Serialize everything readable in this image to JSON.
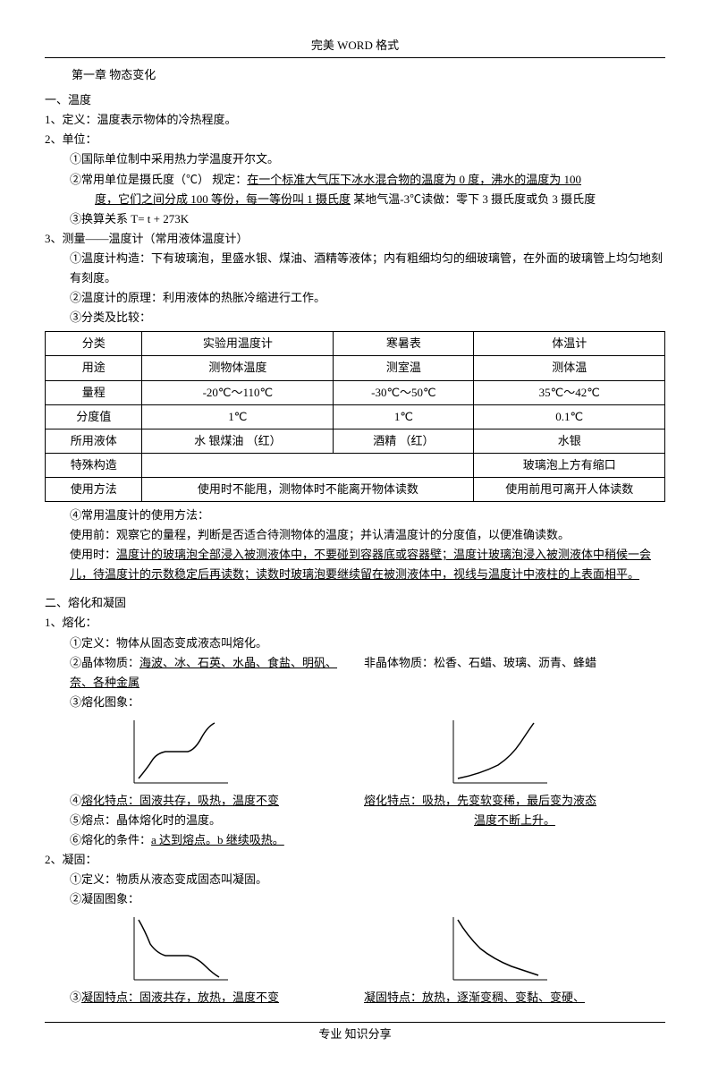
{
  "header": "完美 WORD 格式",
  "footer": "专业 知识分享",
  "chapter": "第一章   物态变化",
  "s1": {
    "title": "一、温度",
    "def": "1、定义：温度表示物体的冷热程度。",
    "unit_label": "2、单位：",
    "u1": "①国际单位制中采用热力学温度开尔文。",
    "u2a": "②常用单位是摄氏度（℃）  规定：",
    "u2b": "在一个标准大气压下冰水混合物的温度为 0 度，沸水的温度为 100",
    "u2c": "度，它们之间分成 100 等份，每一等份叫 1 摄氏度",
    "u2d": "  某地气温-3℃读做：零下 3 摄氏度或负 3 摄氏度",
    "u3": "③换算关系 T= t  + 273K",
    "measure_title": "3、测量——温度计（常用液体温度计）",
    "m1": "①温度计构造：下有玻璃泡，里盛水银、煤油、酒精等液体；内有粗细均匀的细玻璃管，在外面的玻璃管上均匀地刻有刻度。",
    "m2": "②温度计的原理：利用液体的热胀冷缩进行工作。",
    "m3": "③分类及比较：",
    "m4": "④常用温度计的使用方法：",
    "m4a": "使用前：观察它的量程，判断是否适合待测物体的温度；并认清温度计的分度值，以便准确读数。",
    "m4b_a": "使用时：",
    "m4b_b": "温度计的玻璃泡全部浸入被测液体中，不要碰到容器底或容器壁；温度计玻璃泡浸入被测液体中稍候一会儿，待温度计的示数稳定后再读数；读数时玻璃泡要继续留在被测液体中，视线与温度计中液柱的上表面相平。"
  },
  "table": {
    "rows": [
      [
        "分类",
        "实验用温度计",
        "寒暑表",
        "体温计"
      ],
      [
        "用途",
        "测物体温度",
        "测室温",
        "测体温"
      ],
      [
        "量程",
        "-20℃～110℃",
        "-30℃～50℃",
        "35℃～42℃"
      ],
      [
        "分度值",
        "1℃",
        "1℃",
        "0.1℃"
      ],
      [
        "所用液体",
        "水   银煤油  （红）",
        "酒精  （红）",
        "水银"
      ],
      [
        "特殊构造",
        "",
        "",
        "玻璃泡上方有缩口"
      ],
      [
        "使用方法",
        "使用时不能甩，测物体时不能离开物体读数",
        "使用前甩可离开人体读数"
      ]
    ]
  },
  "s2": {
    "title": "二、熔化和凝固",
    "ronghua_title": "1、熔化：",
    "r1": "①定义：物体从固态变成液态叫熔化。",
    "r2a": "②晶体物质：",
    "r2b": "海波、冰、石英、水晶、食盐、明矾、奈、各种金属",
    "r2c": "       非晶体物质：松香、石蜡、玻璃、沥青、蜂蜡",
    "r3": "③熔化图象：",
    "r4a": "④",
    "r4b": "熔化特点：固液共存，吸热，温度不变",
    "r4r_a": "熔化特点：吸热，先变软变稀，最后变为液态",
    "r4r_b": "温度不断上升。",
    "r5": "⑤熔点：晶体熔化时的温度。",
    "r6a": "⑥熔化的条件：",
    "r6b": "a 达到熔点。b 继续吸热。",
    "ninggu_title": "2、凝固：",
    "n1": "①定义：物质从液态变成固态叫凝固。",
    "n2": "②凝固图象：",
    "n3a": "③",
    "n3b": "凝固特点：固液共存，放热，温度不变",
    "n3r": "凝固特点：放热，逐渐变稠、变黏、变硬、"
  }
}
